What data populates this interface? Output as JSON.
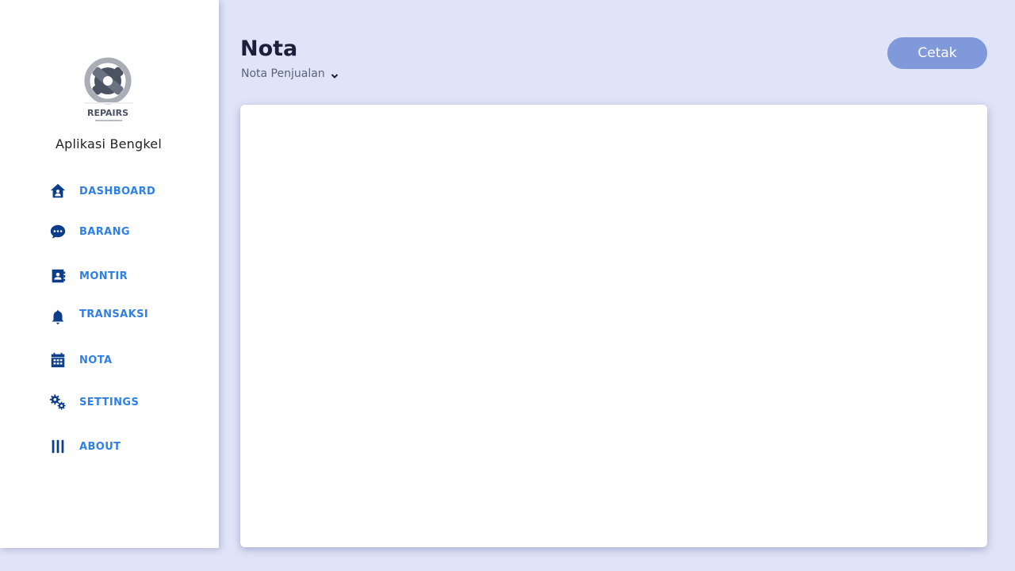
{
  "app": {
    "name": "Aplikasi Bengkel",
    "logo_text": "REPAIRS",
    "logo_icon": "wrench-gear-logo"
  },
  "sidebar": {
    "items": [
      {
        "label": "DASHBOARD",
        "icon": "home-icon"
      },
      {
        "label": "BARANG",
        "icon": "chat-bubble-icon"
      },
      {
        "label": "MONTIR",
        "icon": "contact-card-icon"
      },
      {
        "label": "TRANSAKSI",
        "icon": "bell-icon"
      },
      {
        "label": "NOTA",
        "icon": "calendar-icon"
      },
      {
        "label": "SETTINGS",
        "icon": "gears-icon"
      },
      {
        "label": "ABOUT",
        "icon": "columns-icon"
      }
    ]
  },
  "header": {
    "title": "Nota",
    "subtitle": "Nota Penjualan",
    "print_button": "Cetak"
  },
  "colors": {
    "background": "#dfe4f8",
    "accent": "#2f80e6",
    "icon": "#0c3d8a",
    "button": "#8099da"
  }
}
